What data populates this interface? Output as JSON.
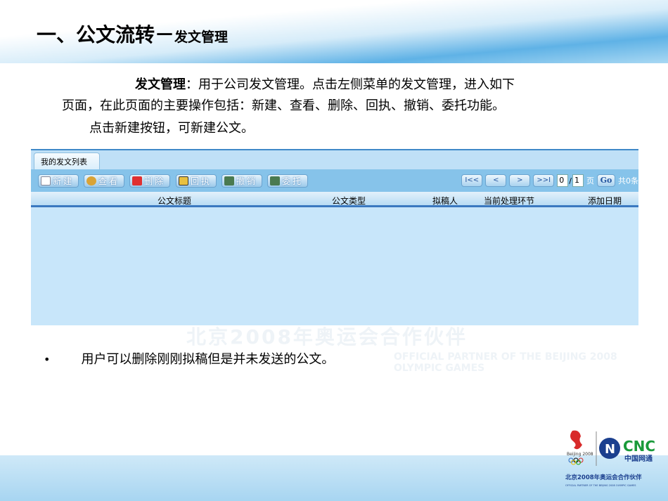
{
  "slide": {
    "title_main": "一、公文流转",
    "title_sep": "－",
    "title_sub": "发文管理"
  },
  "body": {
    "line1_bold": "发文管理",
    "line1_rest": "：用于公司发文管理。点击左侧菜单的发文管理，进入如下",
    "line2": "页面，在此页面的主要操作包括：新建、查看、删除、回执、撤销、委托功能。",
    "line3": "点击新建按钮，可新建公文。",
    "bullet": "用户可以删除刚刚拟稿但是并未发送的公文。"
  },
  "watermark": {
    "cn": "北京2008年奥运会合作伙伴",
    "en": "OFFICIAL PARTNER OF THE BEIJING 2008 OLYMPIC GAMES"
  },
  "panel": {
    "tab": "我的发文列表",
    "buttons": [
      "新建",
      "查看",
      "删除",
      "回执",
      "撤销",
      "委托"
    ],
    "pager": {
      "first": "I<<",
      "prev": "<",
      "next": ">",
      "last": ">>I",
      "current": "0",
      "total": "1",
      "page_label": "页",
      "go": "Go",
      "count": "共0条"
    },
    "columns": [
      "公文标题",
      "公文类型",
      "拟稿人",
      "当前处理环节",
      "添加日期"
    ]
  },
  "logo": {
    "brand": "CNC",
    "brand_cn": "中国网通",
    "beijing": "Beijing 2008",
    "partner_cn": "北京2008年奥运会合作伙伴",
    "partner_en": "OFFICIAL PARTNER OF THE BEIJING 2008 OLYMPIC GAMES"
  }
}
